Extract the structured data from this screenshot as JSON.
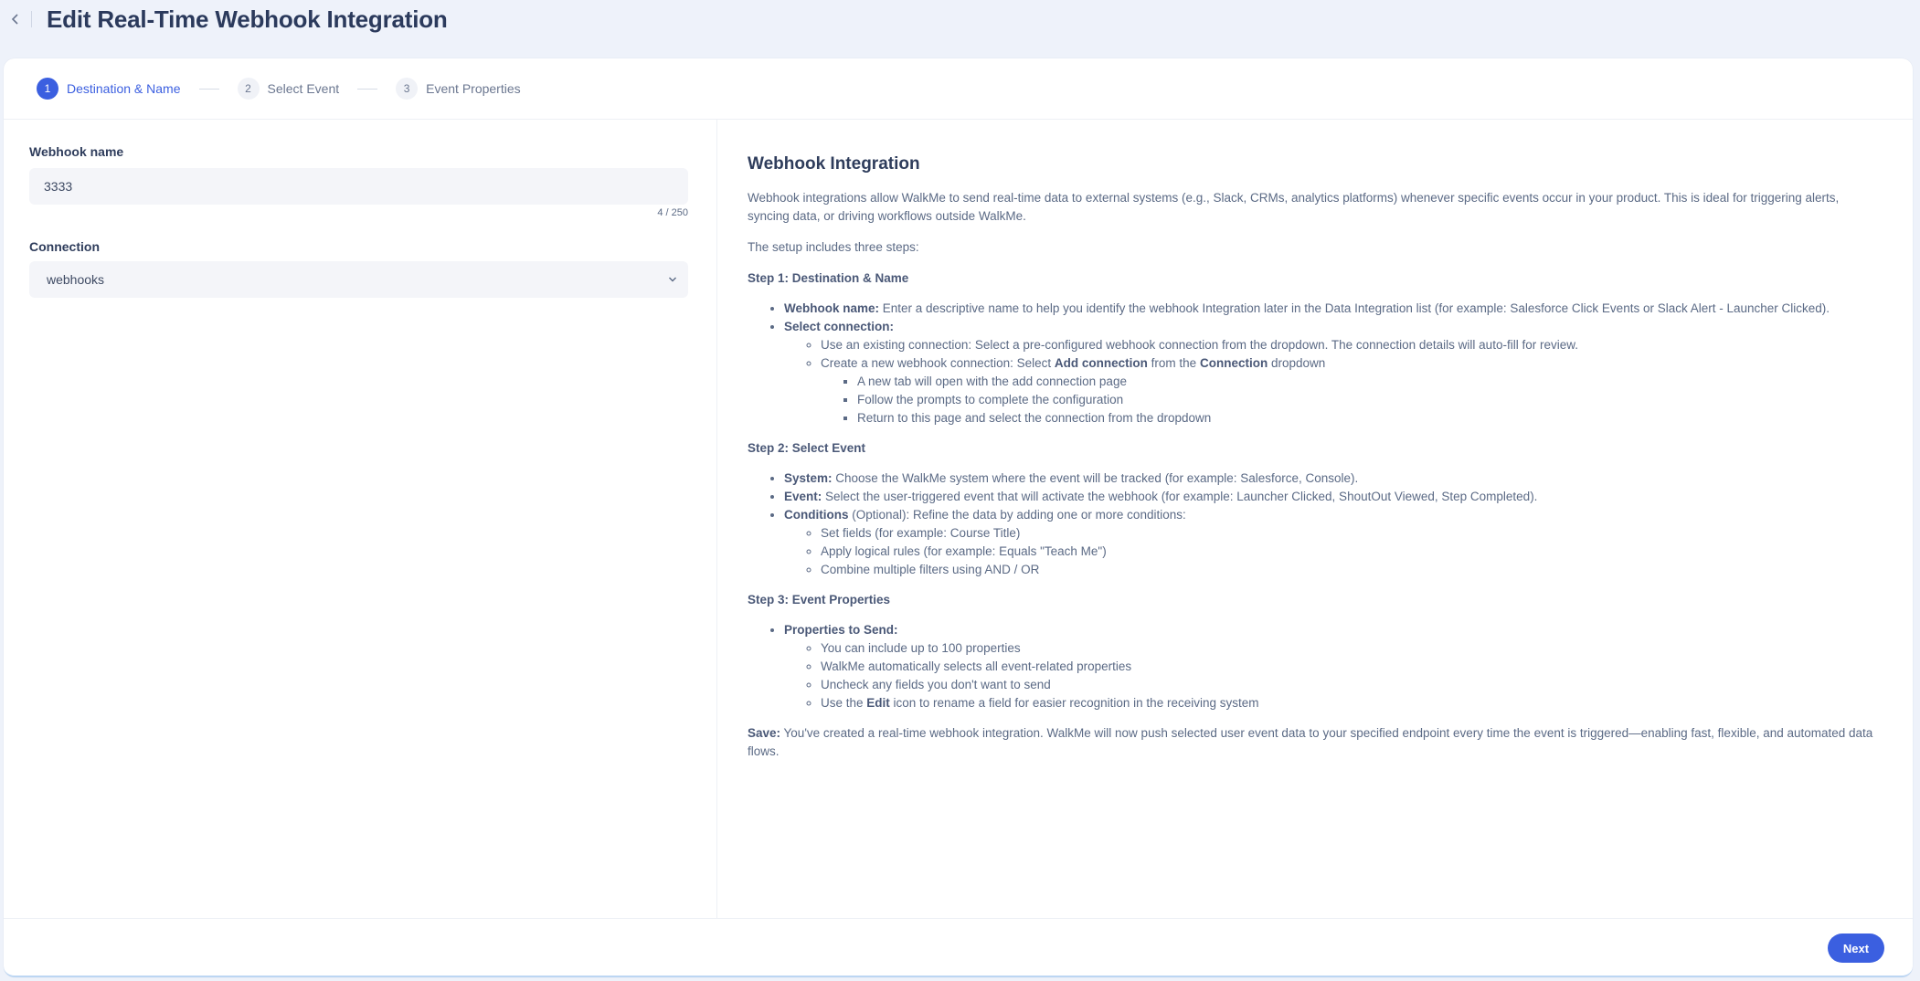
{
  "header": {
    "title": "Edit Real-Time Webhook Integration"
  },
  "stepper": {
    "steps": [
      {
        "num": "1",
        "label": "Destination & Name",
        "active": true
      },
      {
        "num": "2",
        "label": "Select Event",
        "active": false
      },
      {
        "num": "3",
        "label": "Event Properties",
        "active": false
      }
    ]
  },
  "form": {
    "webhook_name_label": "Webhook name",
    "webhook_name_value": "3333",
    "counter": "4 / 250",
    "connection_label": "Connection",
    "connection_value": "webhooks"
  },
  "help": {
    "title": "Webhook Integration",
    "intro": "Webhook integrations allow WalkMe to send real-time data to external systems (e.g., Slack, CRMs, analytics platforms) whenever specific events occur in your product. This is ideal for triggering alerts, syncing data, or driving workflows outside WalkMe.",
    "setup": "The setup includes three steps:",
    "step1": {
      "heading": "Step 1: Destination & Name",
      "name_bold": "Webhook name:",
      "name_text": " Enter a descriptive name to help you identify the webhook Integration later in the Data Integration list (for example: Salesforce Click Events or Slack Alert - Launcher Clicked).",
      "conn_bold": "Select connection:",
      "existing": "Use an existing connection: Select a pre-configured webhook connection from the dropdown. The connection details will auto-fill for review.",
      "create_pre": "Create a new webhook connection: Select ",
      "create_bold1": "Add connection",
      "create_mid": " from the ",
      "create_bold2": "Connection",
      "create_post": " dropdown",
      "sub": [
        "A new tab will open with the add connection page",
        "Follow the prompts to complete the configuration",
        "Return to this page and select the connection from the dropdown"
      ]
    },
    "step2": {
      "heading": "Step 2: Select Event",
      "system_bold": "System:",
      "system_text": " Choose the WalkMe system where the event will be tracked (for example: Salesforce, Console).",
      "event_bold": "Event:",
      "event_text": " Select the user-triggered event that will activate the webhook (for example: Launcher Clicked, ShoutOut Viewed, Step Completed).",
      "cond_bold": "Conditions",
      "cond_text": " (Optional): Refine the data by adding one or more conditions:",
      "sub": [
        "Set fields (for example: Course Title)",
        "Apply logical rules (for example: Equals \"Teach Me\")",
        "Combine multiple filters using AND / OR"
      ]
    },
    "step3": {
      "heading": "Step 3: Event Properties",
      "props_bold": "Properties to Send:",
      "sub": [
        "You can include up to 100 properties",
        "WalkMe automatically selects all event-related properties",
        "Uncheck any fields you don't want to send"
      ],
      "edit_pre": "Use the ",
      "edit_bold": "Edit",
      "edit_post": " icon to rename a field for easier recognition in the receiving system"
    },
    "save_bold": "Save:",
    "save_text": " You've created a real-time webhook integration. WalkMe will now push selected user event data to your specified endpoint every time the event is triggered—enabling fast, flexible, and automated data flows."
  },
  "footer": {
    "next_label": "Next"
  },
  "colors": {
    "accent": "#3b5fe0",
    "background": "#eef2fa",
    "card": "#ffffff"
  }
}
